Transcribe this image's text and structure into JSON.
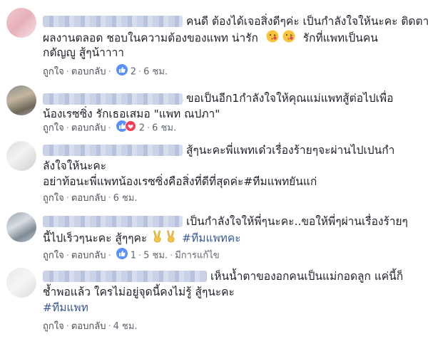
{
  "actions": {
    "like": "ถูกใจ",
    "reply": "ตอบกลับ",
    "edited": "มีการแก้ไข"
  },
  "comments": [
    {
      "lines": [
        "คนดี ต้องได้เจอสิ่งดีๆค่ะ เป็นกำลังใจให้นะคะ ติดตาม",
        "ผลงานตลอด ชอบในความต้องของแพท น่ารัก",
        "รักที่แพทเป็นคน",
        "กตัญญู สู้ๆน้าาาา"
      ],
      "reaction_count": "2",
      "time": "6 ชม."
    },
    {
      "lines": [
        "ขอเป็นอีก1กำลังใจให้คุณแม่แพทสู้ต่อไปเพื่อ",
        "น้องเรซซิ่ง รักเธอเสมอ \"แพท ณปภา\""
      ],
      "reaction_count": "2",
      "time": "6 ชม."
    },
    {
      "lines": [
        "สู้ๆนะคะพี่แพทเด๋วเรื่องร้ายๆจะผ่านไปเปนกำ",
        "ลังใจให้นะคะ",
        "อย่าท้อนะพี่แพทน้องเรซซิ่งคือสิ่งที่ดีที่สุดค่ะ#ทีมแพทยันแก่"
      ],
      "time": "6 ชม."
    },
    {
      "lines": [
        "เป็นกำลังใจให้พี่ๆนะคะ..ขอให้พี่ๆผ่านเรื่องร้ายๆ",
        "นี้ไปเร็วๆนะคะ สู้ๆๆคะ",
        "#ทีมแพทคะ"
      ],
      "reaction_count": "1",
      "time": "5 ชม."
    },
    {
      "lines": [
        "เห็นน้ำตาของอกคนเป็นแม่กอดลูก แค่นี้ก็",
        "ช้ำพอแล้ว ใครไม่อยู่จุดนี้คงไม่รู้ สู้ๆนะคะ",
        "#ทีมแพท"
      ],
      "time": "4 ชม."
    }
  ]
}
